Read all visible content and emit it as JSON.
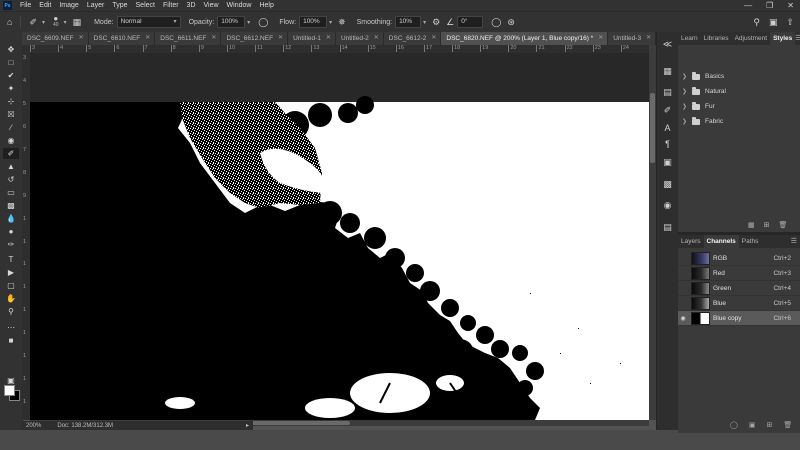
{
  "menubar": {
    "logo": "Ps",
    "items": [
      "File",
      "Edit",
      "Image",
      "Layer",
      "Type",
      "Select",
      "Filter",
      "3D",
      "View",
      "Window",
      "Help"
    ]
  },
  "options": {
    "brush_size": "40",
    "mode_label": "Mode:",
    "mode_value": "Normal",
    "opacity_label": "Opacity:",
    "opacity_value": "100%",
    "flow_label": "Flow:",
    "flow_value": "100%",
    "smoothing_label": "Smoothing:",
    "smoothing_value": "10%",
    "angle_value": "0°"
  },
  "tabs": [
    {
      "label": "DSC_6609.NEF",
      "active": false
    },
    {
      "label": "DSC_6610.NEF",
      "active": false
    },
    {
      "label": "DSC_6611.NEF",
      "active": false
    },
    {
      "label": "DSC_6612.NEF",
      "active": false
    },
    {
      "label": "Untitled-1",
      "active": false
    },
    {
      "label": "Untitled-2",
      "active": false
    },
    {
      "label": "DSC_6612-2",
      "active": false
    },
    {
      "label": "DSC_6820.NEF @ 200% (Layer 1, Blue copy/16) *",
      "active": true
    },
    {
      "label": "Untitled-3",
      "active": false
    }
  ],
  "ruler": {
    "top_ticks": [
      "3",
      "4",
      "5",
      "6",
      "7",
      "8",
      "9",
      "10",
      "11",
      "12",
      "13",
      "14",
      "15",
      "16",
      "17",
      "18",
      "19",
      "20",
      "21",
      "22",
      "23",
      "24"
    ],
    "left_ticks": [
      "3",
      "4",
      "5",
      "6",
      "7",
      "8",
      "9",
      "1",
      "1",
      "1",
      "1",
      "1",
      "1",
      "1",
      "1",
      "1"
    ]
  },
  "status": {
    "zoom": "200%",
    "doc": "Doc: 138.2M/312.3M"
  },
  "styles_panel": {
    "tabs": [
      "Learn",
      "Libraries",
      "Adjustment",
      "Styles"
    ],
    "active_tab": "Styles",
    "groups": [
      "Basics",
      "Natural",
      "Fur",
      "Fabric"
    ]
  },
  "channels_panel": {
    "tabs": [
      "Layers",
      "Channels",
      "Paths"
    ],
    "active_tab": "Channels",
    "rows": [
      {
        "name": "RGB",
        "shortcut": "Ctrl+2",
        "visible": false,
        "selected": false
      },
      {
        "name": "Red",
        "shortcut": "Ctrl+3",
        "visible": false,
        "selected": false
      },
      {
        "name": "Green",
        "shortcut": "Ctrl+4",
        "visible": false,
        "selected": false
      },
      {
        "name": "Blue",
        "shortcut": "Ctrl+5",
        "visible": false,
        "selected": false
      },
      {
        "name": "Blue copy",
        "shortcut": "Ctrl+6",
        "visible": true,
        "selected": true
      }
    ]
  },
  "icons": {
    "home": "home-icon",
    "brush": "brush-icon",
    "search": "search-icon",
    "share": "share-icon",
    "workspace": "workspace-icon",
    "eye": "eye-icon",
    "folder": "folder-icon"
  },
  "colors": {
    "foreground": "#ffffff",
    "background": "#000000",
    "ui_dark": "#323232",
    "panel": "#3a3a3a",
    "selected_row": "#5a5a5a"
  }
}
